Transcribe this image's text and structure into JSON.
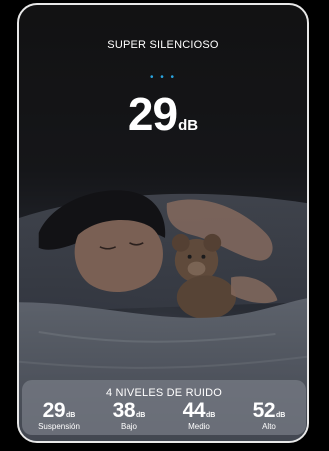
{
  "headline": "SUPER SILENCIOSO",
  "indicator_dots": "• • •",
  "current_level": {
    "value": "29",
    "unit": "dB"
  },
  "panel": {
    "title": "4 NIVELES DE RUIDO",
    "levels": [
      {
        "value": "29",
        "unit": "dB",
        "label": "Suspensión"
      },
      {
        "value": "38",
        "unit": "dB",
        "label": "Bajo"
      },
      {
        "value": "44",
        "unit": "dB",
        "label": "Medio"
      },
      {
        "value": "52",
        "unit": "dB",
        "label": "Alto"
      }
    ]
  },
  "colors": {
    "accent_dots": "#2aa5e0",
    "card_border": "#e8e8e8",
    "text": "#ffffff"
  }
}
